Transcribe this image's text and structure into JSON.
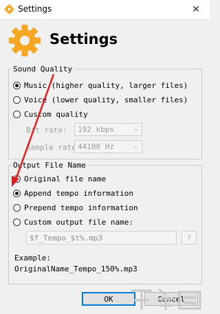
{
  "window": {
    "title": "Settings",
    "close_glyph": "✕"
  },
  "header": {
    "heading": "Settings",
    "icon": "gear-icon",
    "accent": "#f5a623"
  },
  "sound_quality": {
    "legend": "Sound Quality",
    "options": [
      {
        "label": "Music (higher quality, larger files)",
        "checked": true
      },
      {
        "label": "Voice (lower quality, smaller files)",
        "checked": false
      },
      {
        "label": "Custom quality",
        "checked": false
      }
    ],
    "bitrate": {
      "label": "Bit rate:",
      "value": "192 kbps"
    },
    "samplerate": {
      "label": "Sample rate:",
      "value": "44100 Hz"
    }
  },
  "output_file_name": {
    "legend": "Output File Name",
    "options": [
      {
        "label": "Original file name",
        "checked": false
      },
      {
        "label": "Append tempo information",
        "checked": true
      },
      {
        "label": "Prepend tempo information",
        "checked": false
      },
      {
        "label": "Custom output file name:",
        "checked": false
      }
    ],
    "custom_value": "$f_Tempo_$t%.mp3",
    "browse_label": "?",
    "example_label": "Example:",
    "example_value": "OriginalName_Tempo_150%.mp3"
  },
  "buttons": {
    "ok": "OK",
    "cancel": "Cancel"
  },
  "annotation": {
    "color": "#e02020"
  }
}
